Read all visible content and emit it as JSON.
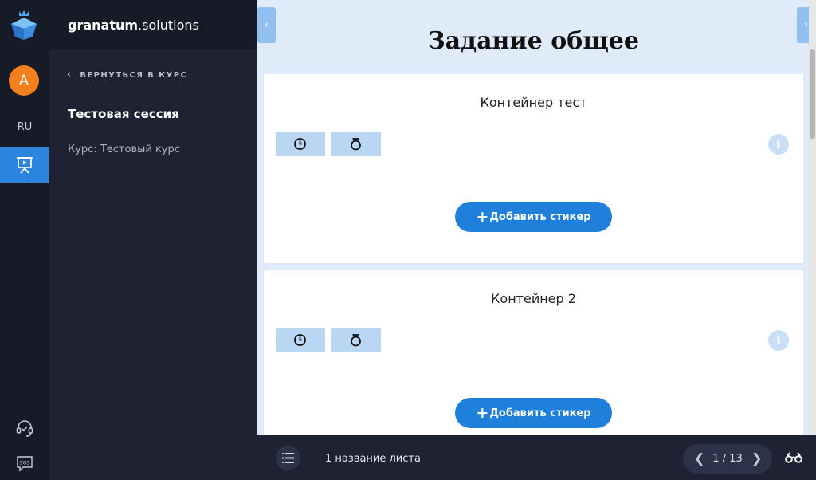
{
  "app": {
    "brand_bold": "granatum",
    "brand_rest": ".solutions"
  },
  "user": {
    "avatar_letter": "А",
    "language": "RU"
  },
  "sidebar": {
    "back_label": "ВЕРНУТЬСЯ В КУРС",
    "session_title": "Тестовая сессия",
    "course": "Курс: Тестовый курс"
  },
  "main": {
    "title": "Задание общее",
    "prev_glyph": "‹",
    "next_glyph": "›",
    "containers": [
      {
        "title": "Контейнер тест",
        "add_label": "Добавить стикер"
      },
      {
        "title": "Контейнер 2",
        "add_label": "Добавить стикер"
      }
    ],
    "info_glyph": "i"
  },
  "bottom": {
    "sheet_name": "1 название листа",
    "page_indicator": "1 / 13"
  },
  "icons": {
    "logo": "granatum-logo-icon",
    "presentation": "presentation-icon",
    "support": "headset-icon",
    "sos": "sos-chat-icon",
    "clock": "clock-icon",
    "stopwatch": "stopwatch-icon",
    "list": "list-icon",
    "binoculars": "binoculars-icon"
  },
  "colors": {
    "accent": "#2b84de",
    "button_blue": "#1f80db",
    "avatar": "#f47f1d",
    "timer_button": "#b9d6f3",
    "canvas": "#dfebf9"
  }
}
